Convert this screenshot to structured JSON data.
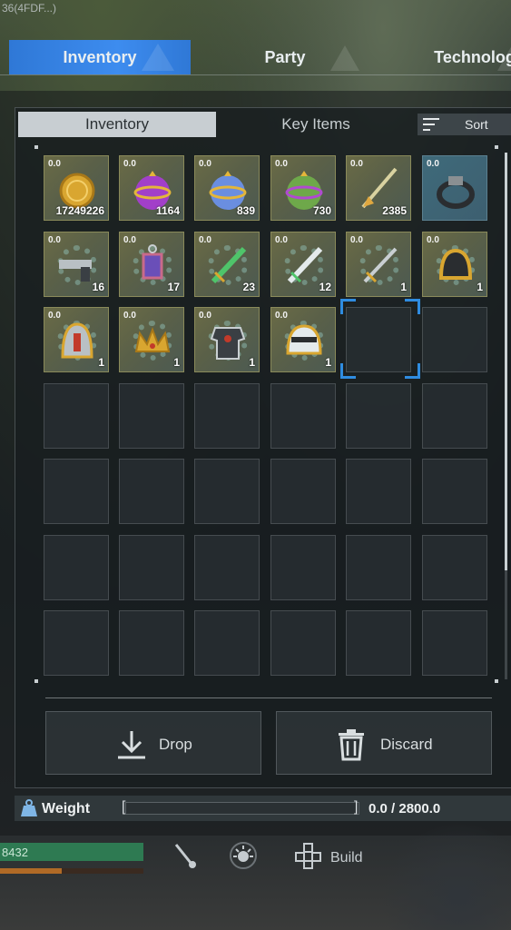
{
  "corner_text": "36(4FDF...)",
  "top_tabs": [
    {
      "label": "Inventory",
      "active": true
    },
    {
      "label": "Party",
      "active": false
    },
    {
      "label": "Technology",
      "active": false
    }
  ],
  "sub_tabs": [
    {
      "label": "Inventory",
      "active": true
    },
    {
      "label": "Key Items",
      "active": false
    }
  ],
  "sort_label": "Sort",
  "slots": [
    {
      "weight": "0.0",
      "qty": "17249226",
      "icon": "gold-coin-icon",
      "style": "gold"
    },
    {
      "weight": "0.0",
      "qty": "1164",
      "icon": "purple-sphere-icon",
      "style": "gold"
    },
    {
      "weight": "0.0",
      "qty": "839",
      "icon": "blue-sphere-icon",
      "style": "gold"
    },
    {
      "weight": "0.0",
      "qty": "730",
      "icon": "green-sphere-icon",
      "style": "gold"
    },
    {
      "weight": "0.0",
      "qty": "2385",
      "icon": "arrow-icon",
      "style": "gold"
    },
    {
      "weight": "0.0",
      "qty": "",
      "icon": "ring-icon",
      "style": "blue"
    },
    {
      "weight": "0.0",
      "qty": "16",
      "icon": "gun-icon",
      "style": "gear"
    },
    {
      "weight": "0.0",
      "qty": "17",
      "icon": "lantern-icon",
      "style": "gear"
    },
    {
      "weight": "0.0",
      "qty": "23",
      "icon": "green-sword-icon",
      "style": "gear"
    },
    {
      "weight": "0.0",
      "qty": "12",
      "icon": "white-sword-icon",
      "style": "gear"
    },
    {
      "weight": "0.0",
      "qty": "1",
      "icon": "sword-icon",
      "style": "gear"
    },
    {
      "weight": "0.0",
      "qty": "1",
      "icon": "gold-helmet-icon",
      "style": "gear"
    },
    {
      "weight": "0.0",
      "qty": "1",
      "icon": "knight-helmet-icon",
      "style": "gear"
    },
    {
      "weight": "0.0",
      "qty": "1",
      "icon": "crown-icon",
      "style": "gear"
    },
    {
      "weight": "0.0",
      "qty": "1",
      "icon": "armor-icon",
      "style": "gear"
    },
    {
      "weight": "0.0",
      "qty": "1",
      "icon": "visor-helmet-icon",
      "style": "gear"
    }
  ],
  "total_slots": 42,
  "selected_slot": 16,
  "actions": {
    "drop_label": "Drop",
    "discard_label": "Discard"
  },
  "weight": {
    "label": "Weight",
    "value_text": "0.0 / 2800.0",
    "fraction": 0.0
  },
  "hud": {
    "hp_text": "8432",
    "build_label": "Build"
  },
  "colors": {
    "accent": "#3d8cef",
    "slot_gold": "#6a6b46",
    "slot_blue": "#3f6a7a",
    "hp": "#2e7a52",
    "sp": "#b06a26"
  }
}
